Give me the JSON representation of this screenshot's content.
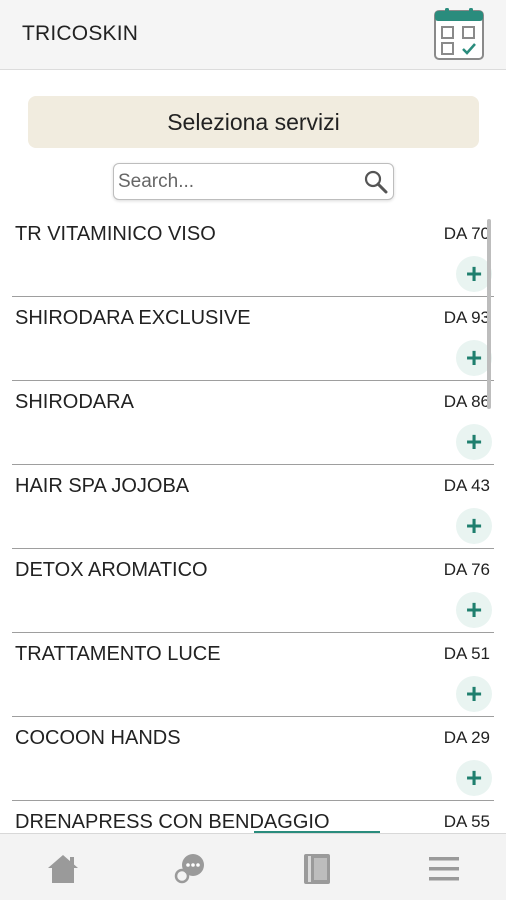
{
  "header": {
    "title": "TRICOSKIN",
    "calendar_icon": "calendar-check-icon"
  },
  "banner": {
    "label": "Seleziona servizi"
  },
  "search": {
    "placeholder": "Search...",
    "value": "",
    "icon": "search-icon"
  },
  "services": [
    {
      "name": "TR VITAMINICO VISO",
      "price": "DA 70"
    },
    {
      "name": "SHIRODARA EXCLUSIVE",
      "price": "DA 93"
    },
    {
      "name": "SHIRODARA",
      "price": "DA 86"
    },
    {
      "name": "HAIR SPA JOJOBA",
      "price": "DA 43"
    },
    {
      "name": "DETOX AROMATICO",
      "price": "DA 76"
    },
    {
      "name": "TRATTAMENTO LUCE",
      "price": "DA 51"
    },
    {
      "name": "COCOON HANDS",
      "price": "DA 29"
    },
    {
      "name": "DRENAPRESS CON BENDAGGIO",
      "price": "DA 55"
    }
  ],
  "add_symbol": "+",
  "bottom_nav": {
    "items": [
      {
        "icon": "home-icon"
      },
      {
        "icon": "chat-icon"
      },
      {
        "icon": "book-icon",
        "active": true
      },
      {
        "icon": "menu-icon"
      }
    ]
  },
  "colors": {
    "accent": "#2a8c7d",
    "banner_bg": "#f1ecdf",
    "add_bg": "#e9f4f1"
  }
}
